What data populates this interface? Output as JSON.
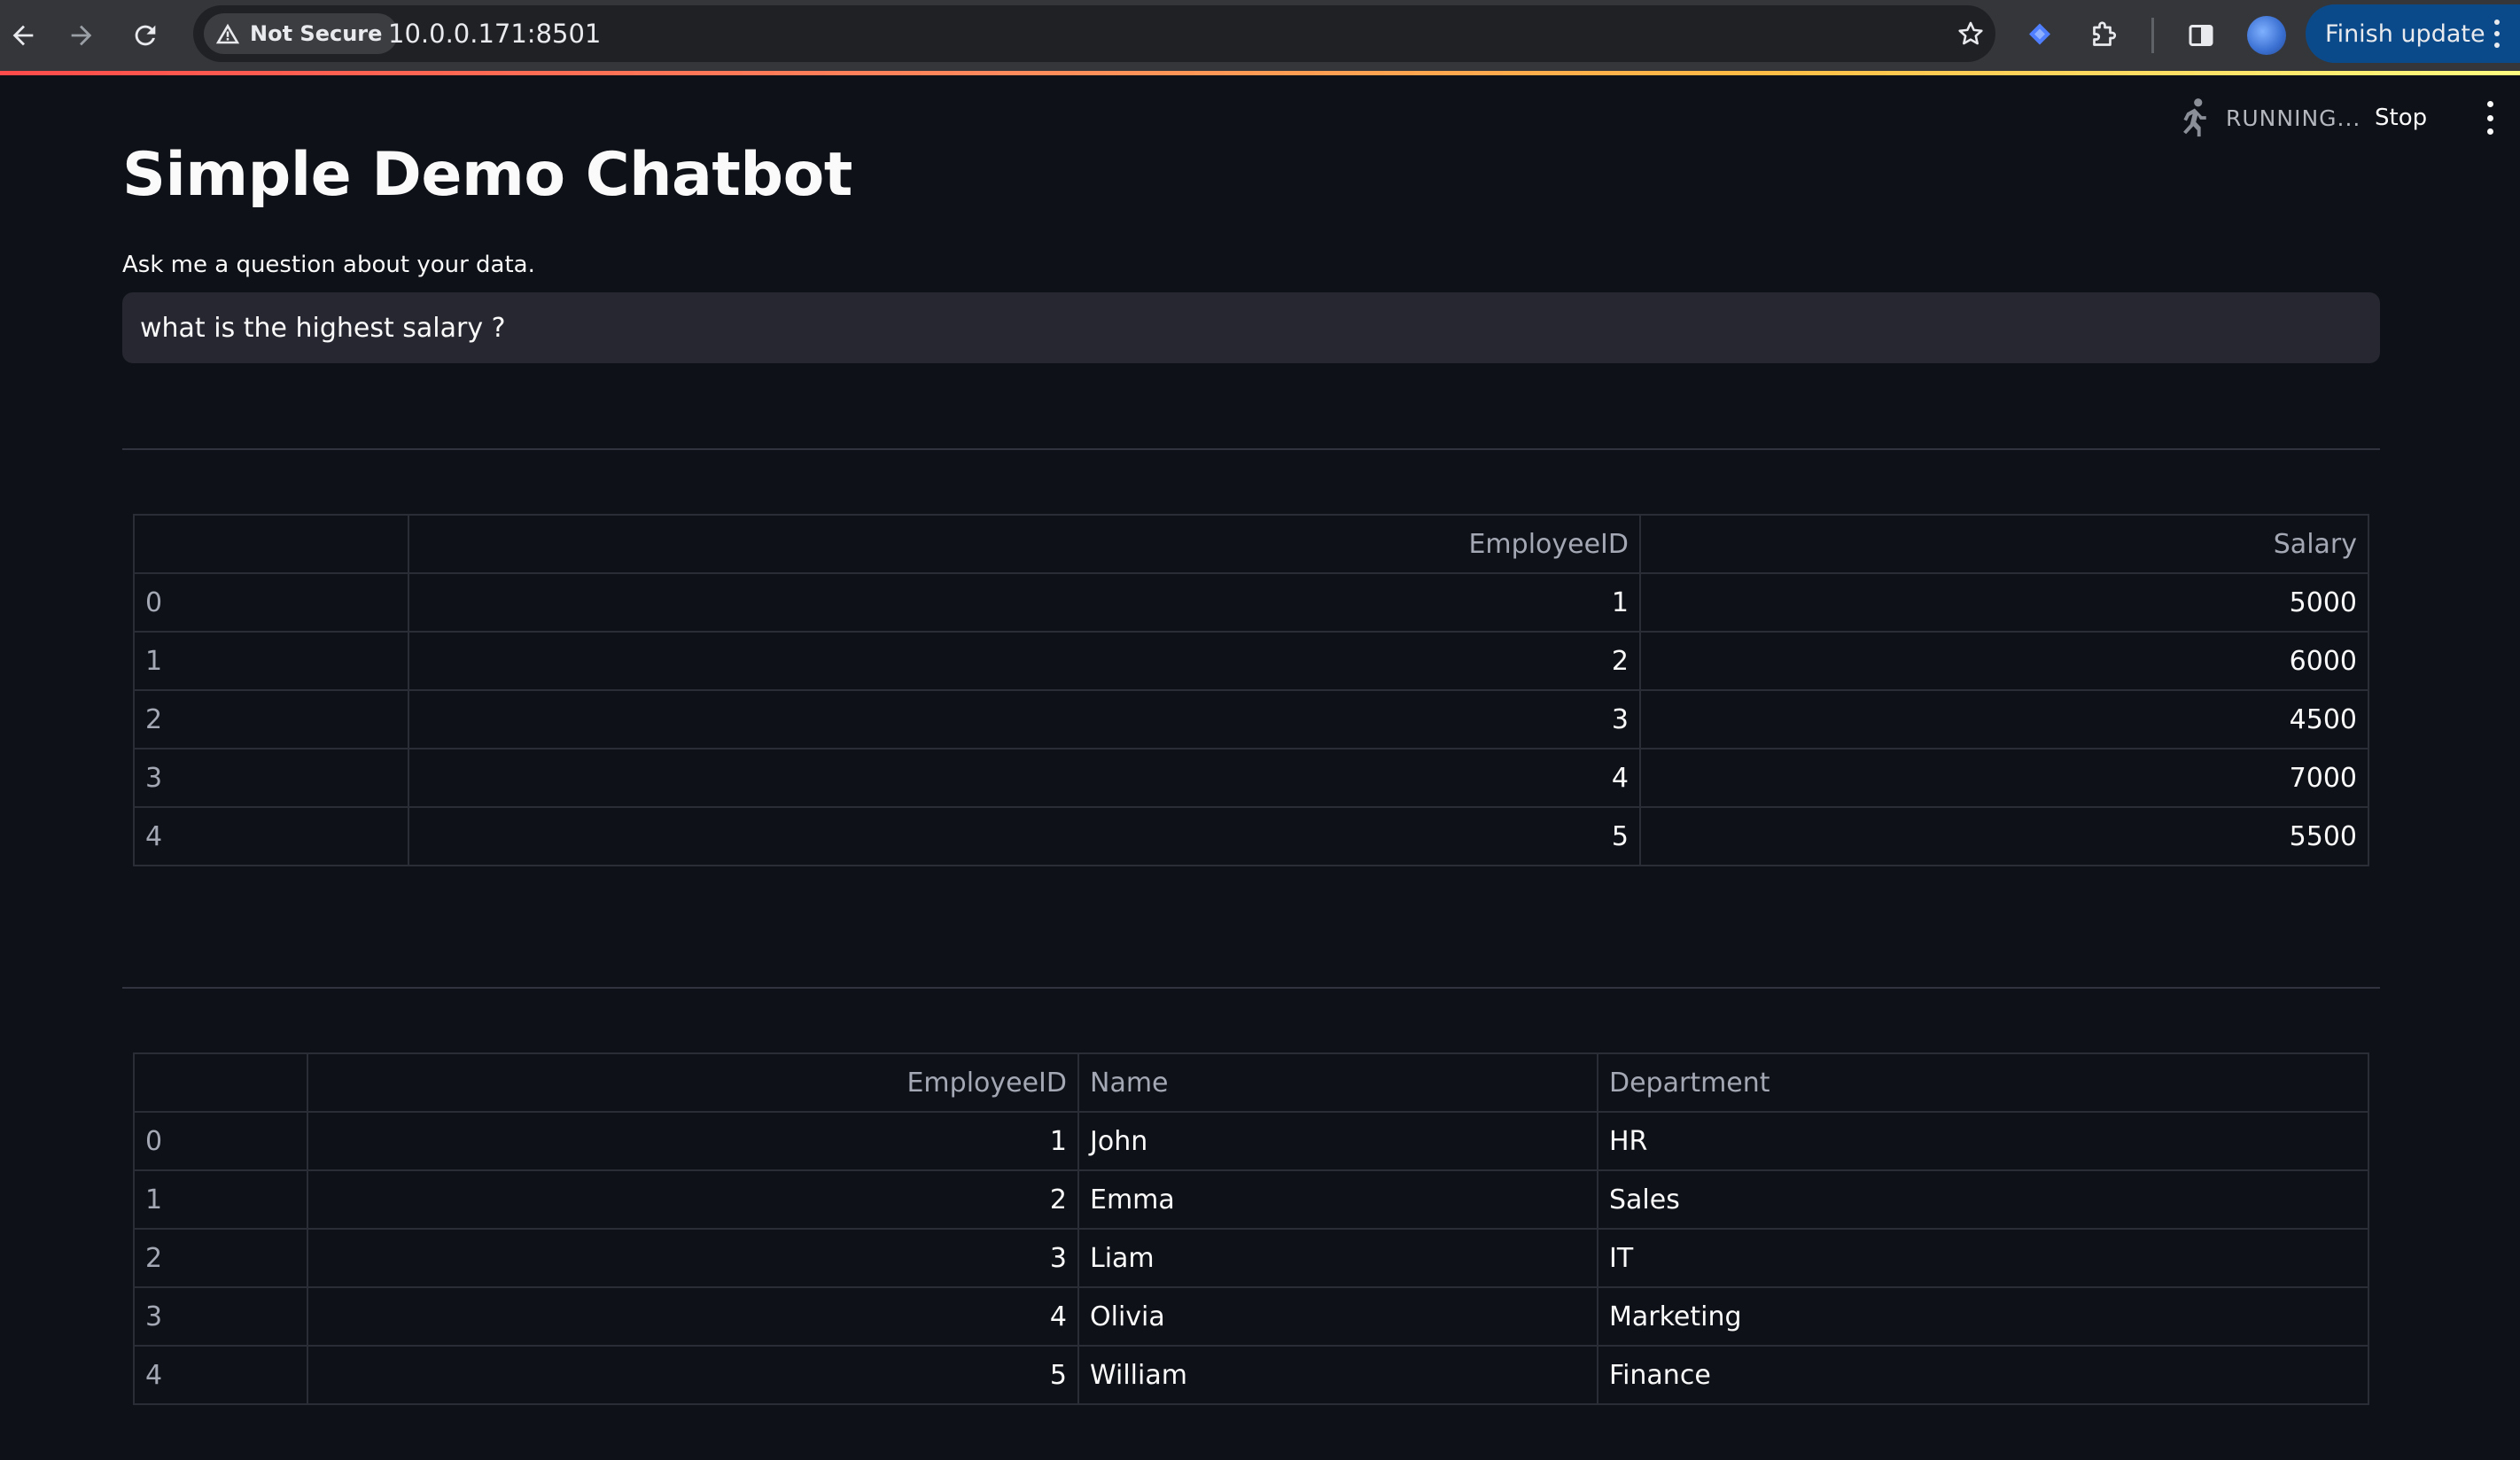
{
  "browser": {
    "security_label": "Not Secure",
    "url": "10.0.0.171:8501",
    "update_label": "Finish update"
  },
  "app_header": {
    "status_label": "RUNNING...",
    "stop_label": "Stop"
  },
  "main": {
    "title": "Simple Demo Chatbot",
    "input_label": "Ask me a question about your data.",
    "input_value": "what is the highest salary ?"
  },
  "salary_table": {
    "columns": [
      "",
      "EmployeeID",
      "Salary"
    ],
    "rows": [
      {
        "index": "0",
        "EmployeeID": "1",
        "Salary": "5000"
      },
      {
        "index": "1",
        "EmployeeID": "2",
        "Salary": "6000"
      },
      {
        "index": "2",
        "EmployeeID": "3",
        "Salary": "4500"
      },
      {
        "index": "3",
        "EmployeeID": "4",
        "Salary": "7000"
      },
      {
        "index": "4",
        "EmployeeID": "5",
        "Salary": "5500"
      }
    ]
  },
  "employee_table": {
    "columns": [
      "",
      "EmployeeID",
      "Name",
      "Department"
    ],
    "rows": [
      {
        "index": "0",
        "EmployeeID": "1",
        "Name": "John",
        "Department": "HR"
      },
      {
        "index": "1",
        "EmployeeID": "2",
        "Name": "Emma",
        "Department": "Sales"
      },
      {
        "index": "2",
        "EmployeeID": "3",
        "Name": "Liam",
        "Department": "IT"
      },
      {
        "index": "3",
        "EmployeeID": "4",
        "Name": "Olivia",
        "Department": "Marketing"
      },
      {
        "index": "4",
        "EmployeeID": "5",
        "Name": "William",
        "Department": "Finance"
      }
    ]
  },
  "icons": {
    "back": "arrow-left-icon",
    "forward": "arrow-right-icon",
    "reload": "reload-icon",
    "warning": "warning-triangle-icon",
    "bookmark": "star-icon",
    "extension_a": "diamond-extension-icon",
    "extensions": "puzzle-icon",
    "side_panel": "side-panel-icon",
    "running": "running-person-icon"
  },
  "colors": {
    "background": "#0e1117",
    "chrome": "#35363a",
    "input_bg": "#262730",
    "update_button": "#0b4a8a",
    "accent": "#ff4b4b"
  }
}
